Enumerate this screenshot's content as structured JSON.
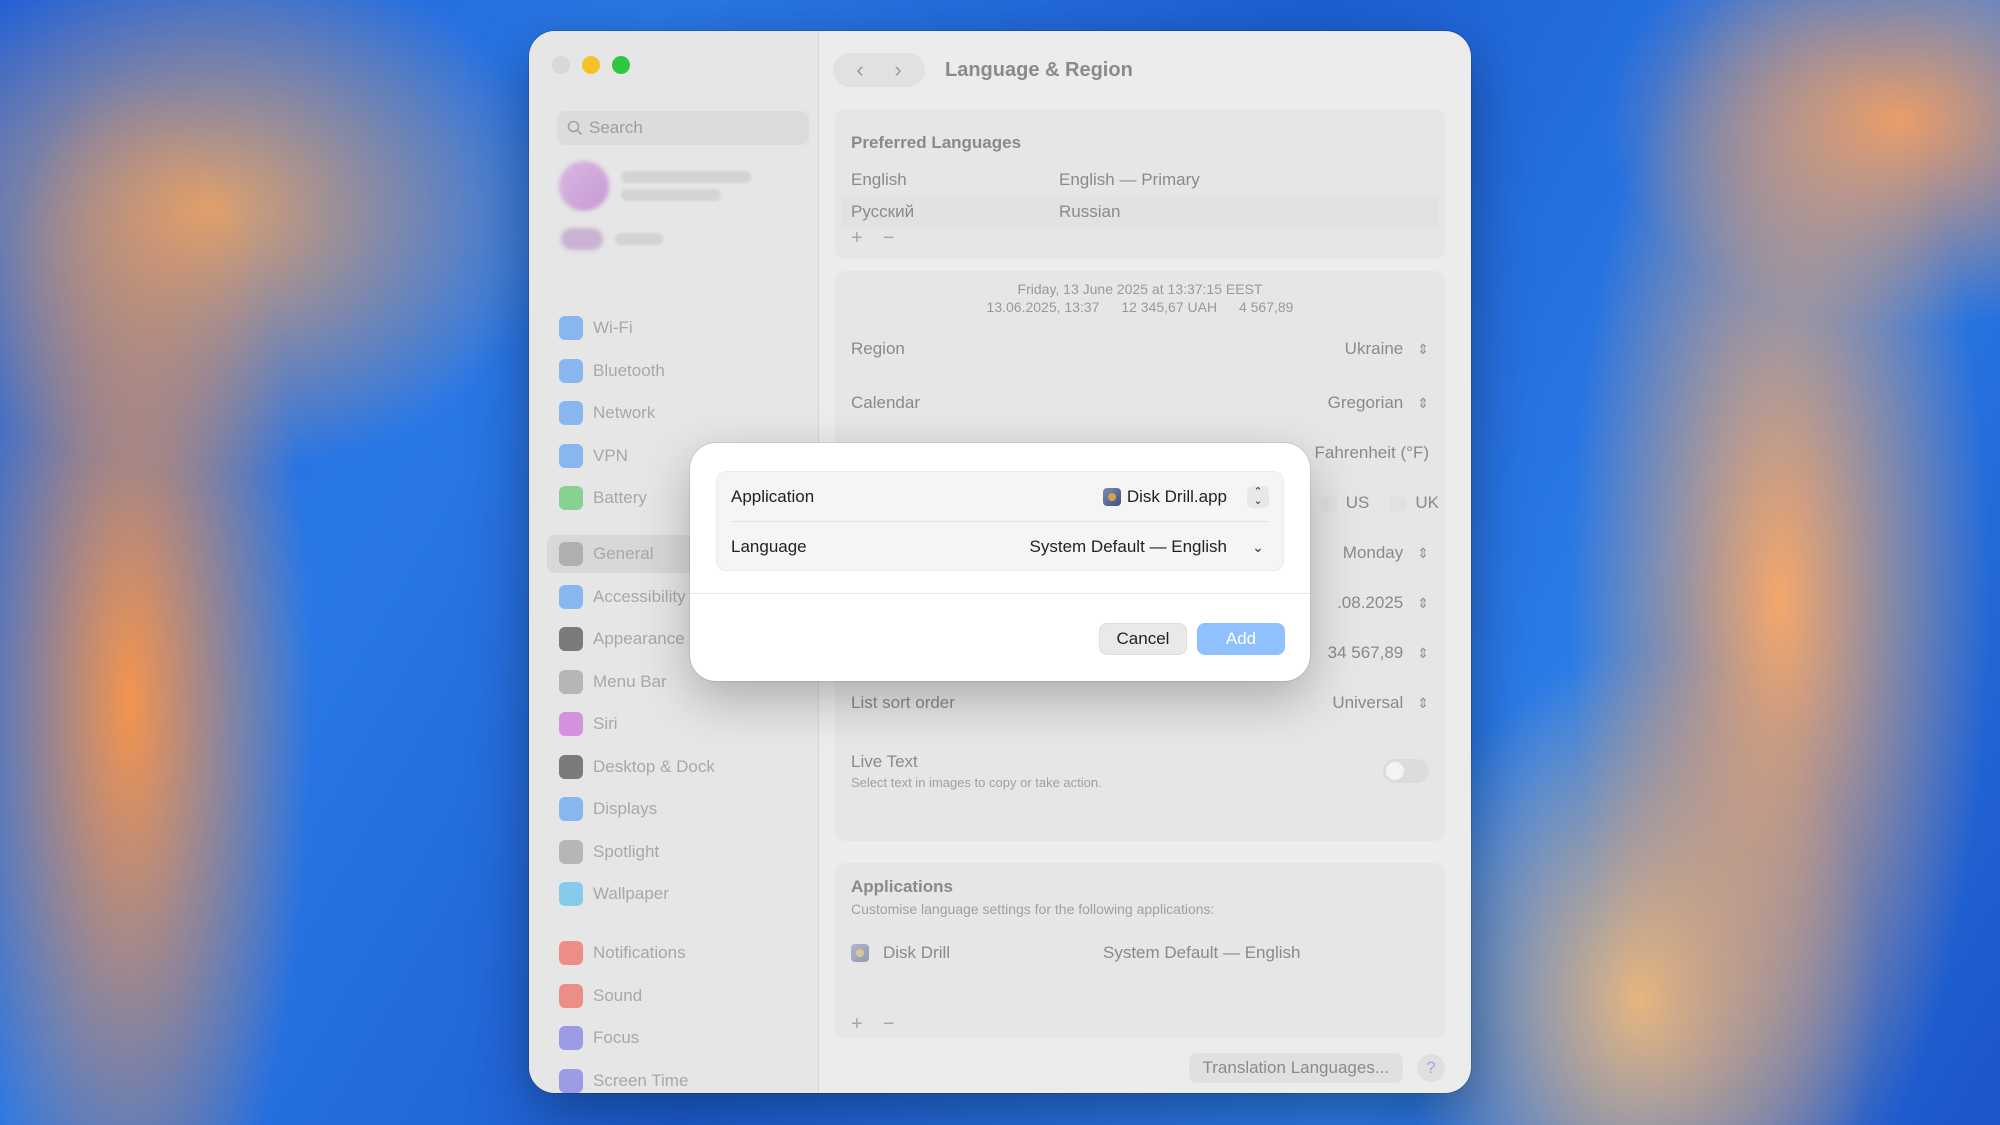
{
  "window": {
    "title": "Language & Region",
    "nav_back": "‹",
    "nav_forward": "›"
  },
  "sidebar": {
    "search_placeholder": "Search",
    "items_group1": [
      {
        "label": "Wi-Fi",
        "icon": "wifi-icon",
        "color": "#3a8ef5"
      },
      {
        "label": "Bluetooth",
        "icon": "bluetooth-icon",
        "color": "#3a8ef5"
      },
      {
        "label": "Network",
        "icon": "globe-icon",
        "color": "#3a8ef5"
      },
      {
        "label": "VPN",
        "icon": "vpn-icon",
        "color": "#3a8ef5"
      },
      {
        "label": "Battery",
        "icon": "battery-icon",
        "color": "#3bbf4a"
      }
    ],
    "items_group2": [
      {
        "label": "General",
        "icon": "gear-icon",
        "color": "#8e8e93"
      },
      {
        "label": "Accessibility",
        "icon": "accessibility-icon",
        "color": "#3a8ef5"
      },
      {
        "label": "Appearance",
        "icon": "appearance-icon",
        "color": "#222222"
      },
      {
        "label": "Menu Bar",
        "icon": "menubar-icon",
        "color": "#8e8e93"
      },
      {
        "label": "Siri",
        "icon": "siri-icon",
        "color": "#c34bd7"
      },
      {
        "label": "Desktop & Dock",
        "icon": "dock-icon",
        "color": "#222222"
      },
      {
        "label": "Displays",
        "icon": "displays-icon",
        "color": "#3a8ef5"
      },
      {
        "label": "Spotlight",
        "icon": "spotlight-icon",
        "color": "#8e8e93"
      },
      {
        "label": "Wallpaper",
        "icon": "wallpaper-icon",
        "color": "#38b4f0"
      }
    ],
    "items_group3": [
      {
        "label": "Notifications",
        "icon": "bell-icon",
        "color": "#f0443a"
      },
      {
        "label": "Sound",
        "icon": "speaker-icon",
        "color": "#f0443a"
      },
      {
        "label": "Focus",
        "icon": "moon-icon",
        "color": "#5e5ce6"
      },
      {
        "label": "Screen Time",
        "icon": "hourglass-icon",
        "color": "#5e5ce6"
      }
    ]
  },
  "preferred_languages": {
    "title": "Preferred Languages",
    "rows": [
      {
        "name": "English",
        "desc": "English — Primary"
      },
      {
        "name": "Русский",
        "desc": "Russian"
      }
    ],
    "add": "+",
    "remove": "−"
  },
  "format_preview": {
    "line1": "Friday, 13 June 2025 at 13:37:15 EEST",
    "line2a": "13.06.2025, 13:37",
    "line2b": "12 345,67 UAH",
    "line2c": "4 567,89"
  },
  "settings": {
    "region_label": "Region",
    "region_value": "Ukraine",
    "calendar_label": "Calendar",
    "calendar_value": "Gregorian",
    "temperature_value": "Fahrenheit (°F)",
    "measurement_opt_us": "US",
    "measurement_opt_uk": "UK",
    "first_day_value": "Monday",
    "date_format_value": ".08.2025",
    "number_format_value": "34 567,89",
    "sort_label": "List sort order",
    "sort_value": "Universal"
  },
  "live_text": {
    "label": "Live Text",
    "desc": "Select text in images to copy or take action."
  },
  "applications": {
    "title": "Applications",
    "desc": "Customise language settings for the following applications:",
    "rows": [
      {
        "name": "Disk Drill",
        "value": "System Default — English"
      }
    ],
    "add": "+",
    "remove": "−"
  },
  "footer": {
    "translation_button": "Translation Languages...",
    "help": "?"
  },
  "dialog": {
    "application_label": "Application",
    "application_value": "Disk Drill.app",
    "language_label": "Language",
    "language_value": "System Default — English",
    "cancel": "Cancel",
    "add": "Add",
    "accent_color": "#8fc0ff"
  }
}
